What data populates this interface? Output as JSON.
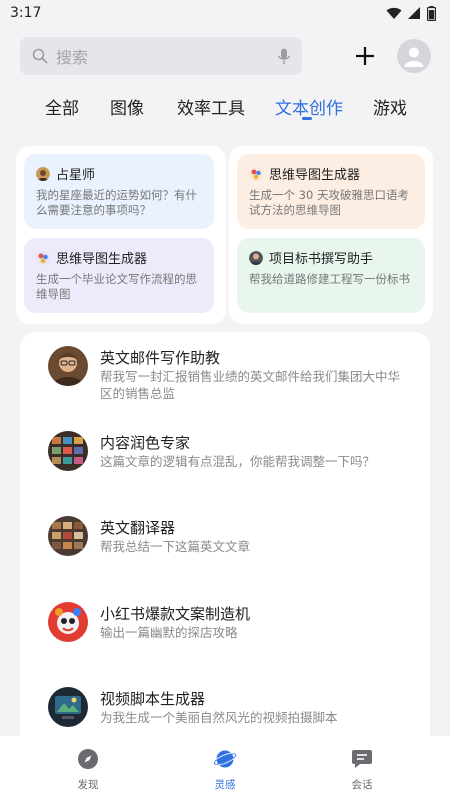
{
  "status": {
    "time": "3:17"
  },
  "search": {
    "placeholder": "搜索"
  },
  "tabs": [
    {
      "label": "全部"
    },
    {
      "label": "图像"
    },
    {
      "label": "效率工具"
    },
    {
      "label": "文本创作",
      "active": true
    },
    {
      "label": "游戏"
    }
  ],
  "prompt_cards": [
    {
      "title": "占星师",
      "desc": "我的星座最近的运势如何？有什么需要注意的事项吗？",
      "bg": "#e9f2fe"
    },
    {
      "title": "思维导图生成器",
      "desc": "生成一个毕业论文写作流程的思维导图",
      "bg": "#efeafb"
    },
    {
      "title": "思维导图生成器",
      "desc": "生成一个 30 天攻破雅思口语考试方法的思维导图",
      "bg": "#fdeee3"
    },
    {
      "title": "项目标书撰写助手",
      "desc": "帮我给道路修建工程写一份标书",
      "bg": "#e8f6ee"
    }
  ],
  "bots": [
    {
      "title": "英文邮件写作助教",
      "desc": "帮我写一封汇报销售业绩的英文邮件给我们集团大中华区的销售总监",
      "icon": "portrait-avatar"
    },
    {
      "title": "内容润色专家",
      "desc": "这篇文章的逻辑有点混乱，你能帮我调整一下吗？",
      "icon": "tv-grid-avatar"
    },
    {
      "title": "英文翻译器",
      "desc": "帮我总结一下这篇英文文章",
      "icon": "book-grid-avatar"
    },
    {
      "title": "小红书爆款文案制造机",
      "desc": "输出一篇幽默的探店攻略",
      "icon": "red-mascot-avatar"
    },
    {
      "title": "视频脚本生成器",
      "desc": "为我生成一个美丽自然风光的视频拍摄脚本",
      "icon": "screen-avatar"
    }
  ],
  "bottom_nav": [
    {
      "label": "发现"
    },
    {
      "label": "灵感",
      "active": true
    },
    {
      "label": "会话"
    }
  ],
  "colors": {
    "accent": "#2f6fe0",
    "background": "#f3f3f5"
  }
}
